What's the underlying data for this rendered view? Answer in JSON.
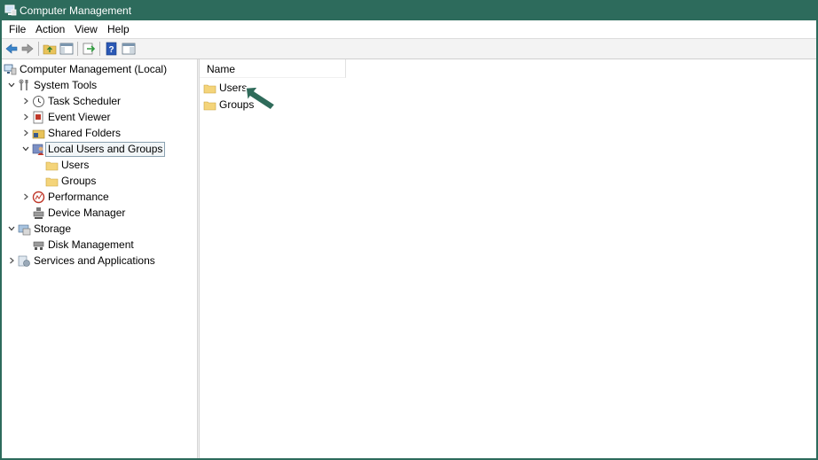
{
  "window": {
    "title": "Computer Management"
  },
  "menu": [
    "File",
    "Action",
    "View",
    "Help"
  ],
  "toolbar": {
    "buttons": [
      "back-arrow-icon",
      "forward-arrow-icon",
      "up-folder-icon",
      "show-hide-tree-icon",
      "export-list-icon",
      "help-icon",
      "properties-icon"
    ]
  },
  "tree": {
    "root": "Computer Management (Local)",
    "system_tools": "System Tools",
    "task_scheduler": "Task Scheduler",
    "event_viewer": "Event Viewer",
    "shared_folders": "Shared Folders",
    "local_users_groups": "Local Users and Groups",
    "users": "Users",
    "groups": "Groups",
    "performance": "Performance",
    "device_manager": "Device Manager",
    "storage": "Storage",
    "disk_management": "Disk Management",
    "services_apps": "Services and Applications"
  },
  "list": {
    "column_name": "Name",
    "items": [
      "Users",
      "Groups"
    ]
  },
  "colors": {
    "titlebar": "#2d6b5c",
    "arrow": "#2f6b5a",
    "folder": "#f4d47a"
  }
}
